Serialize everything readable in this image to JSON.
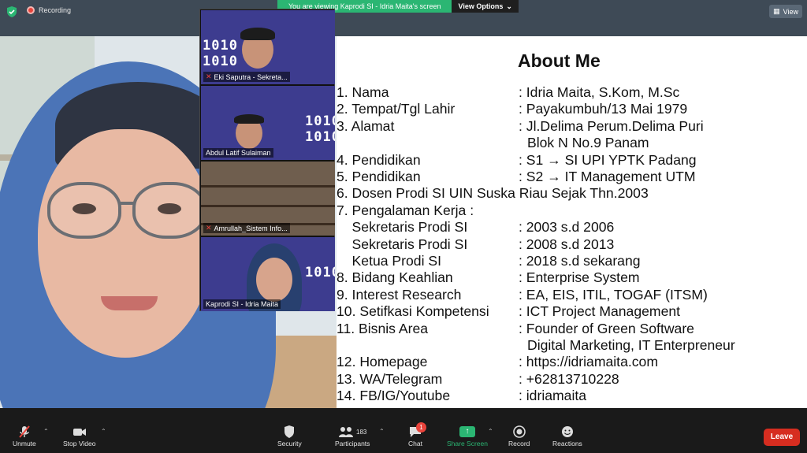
{
  "topbar": {
    "recording_label": "Recording",
    "viewing_text": "You are viewing Kaprodi SI - Idria Maita's screen",
    "view_options_label": "View Options",
    "view_button_label": "View",
    "accent_green": "#2bb673",
    "record_red": "#e9433b"
  },
  "slide": {
    "title": "About Me",
    "rows": [
      {
        "a": "1. Nama",
        "b": ": Idria Maita, S.Kom, M.Sc"
      },
      {
        "a": "2. Tempat/Tgl Lahir",
        "b": ": Payakumbuh/13 Mai 1979"
      },
      {
        "a": "3. Alamat",
        "b": ": Jl.Delima Perum.Delima Puri"
      },
      {
        "a": "",
        "c": "Blok N No.9 Panam"
      },
      {
        "a": "4. Pendidikan",
        "b": ": S1 → SI UPI YPTK Padang"
      },
      {
        "a": "5. Pendidikan",
        "b": ": S2 → IT Management UTM"
      },
      {
        "a": "6. Dosen Prodi SI UIN Suska Riau Sejak Thn.2003"
      },
      {
        "a": "7. Pengalaman Kerja :"
      },
      {
        "a": "    Sekretaris Prodi SI",
        "b": ": 2003 s.d 2006"
      },
      {
        "a": "    Sekretaris Prodi SI",
        "b": ": 2008 s.d 2013"
      },
      {
        "a": "    Ketua Prodi SI",
        "b": ": 2018 s.d sekarang"
      },
      {
        "a": "8. Bidang Keahlian",
        "b": ": Enterprise System"
      },
      {
        "a": "9. Interest Research",
        "b": ": EA, EIS, ITIL, TOGAF (ITSM)"
      },
      {
        "a": "10. Setifkasi Kompetensi",
        "b": ": ICT Project Management"
      },
      {
        "a": "11. Bisnis Area",
        "b": ": Founder of Green Software"
      },
      {
        "a": "",
        "c": "Digital Marketing, IT Enterpreneur"
      },
      {
        "a": "12. Homepage",
        "b": ": https://idriamaita.com"
      },
      {
        "a": "13. WA/Telegram",
        "b": ": +62813710228"
      },
      {
        "a": "14. FB/IG/Youtube",
        "b": ": idriamaita"
      }
    ]
  },
  "gallery": {
    "tiles": [
      {
        "name": "Eki Saputra - Sekreta...",
        "muted": true
      },
      {
        "name": "Abdul Latif Sulaiman",
        "muted": false
      },
      {
        "name": "Amrullah_Sistem Info...",
        "muted": true
      },
      {
        "name": "Kaprodi SI - Idria Maita",
        "muted": false
      }
    ],
    "binary_text": "1010"
  },
  "toolbar": {
    "unmute": "Unmute",
    "stop_video": "Stop Video",
    "security": "Security",
    "participants": "Participants",
    "participants_count": "183",
    "chat": "Chat",
    "chat_badge": "1",
    "share_screen": "Share Screen",
    "record": "Record",
    "reactions": "Reactions",
    "leave": "Leave"
  }
}
